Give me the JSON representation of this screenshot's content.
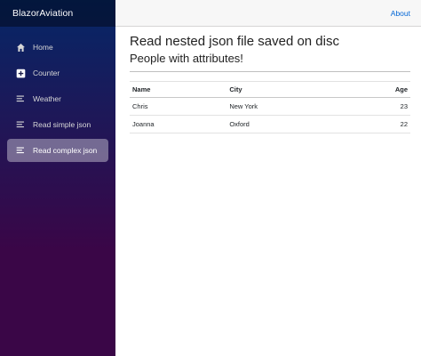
{
  "app": {
    "brand": "BlazorAviation"
  },
  "header": {
    "about_label": "About"
  },
  "sidebar": {
    "items": [
      {
        "label": "Home",
        "icon": "home-icon",
        "active": false
      },
      {
        "label": "Counter",
        "icon": "plus-icon",
        "active": false
      },
      {
        "label": "Weather",
        "icon": "list-icon",
        "active": false
      },
      {
        "label": "Read simple json",
        "icon": "list-icon",
        "active": false
      },
      {
        "label": "Read complex json",
        "icon": "list-icon",
        "active": true
      }
    ]
  },
  "main": {
    "title": "Read nested json file saved on disc",
    "subtitle": "People with attributes!",
    "table": {
      "headers": {
        "name": "Name",
        "city": "City",
        "age": "Age"
      },
      "rows": [
        {
          "name": "Chris",
          "city": "New York",
          "age": "23"
        },
        {
          "name": "Joanna",
          "city": "Oxford",
          "age": "22"
        }
      ]
    }
  },
  "colors": {
    "sidebar_top": "#052767",
    "sidebar_bottom": "#3a0647",
    "link": "#0366d6"
  }
}
